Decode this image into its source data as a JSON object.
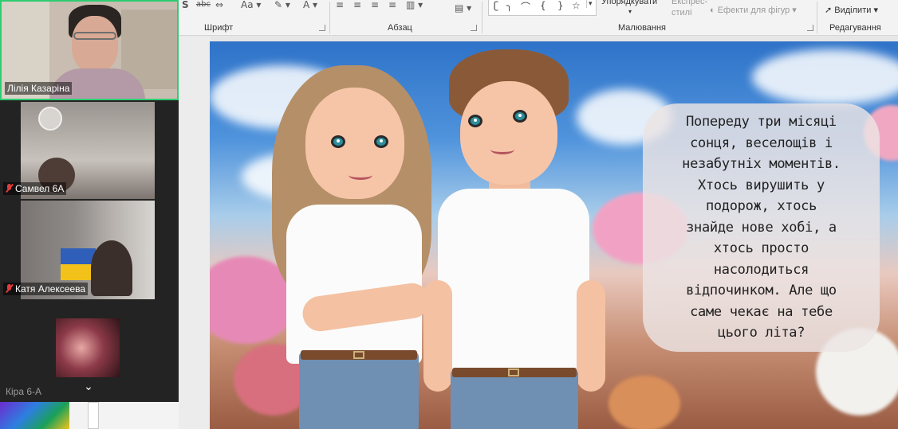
{
  "ribbon": {
    "groups": [
      {
        "label": "Шрифт"
      },
      {
        "label": "Абзац"
      },
      {
        "label": "Малювання"
      },
      {
        "label": "Редагування"
      }
    ],
    "arrange_label": "Упорядкувати",
    "quick_styles_line1": "Експрес-",
    "quick_styles_line2": "стилі",
    "shape_effects_label": "Ефекти для фігур",
    "select_label": "Виділити",
    "font_icons": [
      "strikethrough-icon",
      "abc-icon",
      "change-case-icon",
      "highlight-icon",
      "font-color-icon"
    ],
    "paragraph_icons": [
      "align-left-icon",
      "align-center-icon",
      "align-right-icon",
      "justify-icon"
    ]
  },
  "slide": {
    "text": "Попереду три місяці сонця, веселощів і незабутніх моментів. Хтось вирушить у подорож, хтось знайде нове хобі, а хтось просто насолодиться відпочинком. Але що саме чекає на тебе цього літа?",
    "text_lines": [
      "Попереду три місяці",
      "сонця, веселощів і",
      "незабутніх моментів.",
      "Хтось вирушить у",
      "подорож, хтось",
      "знайде нове хобі, а",
      "хтось просто",
      "насолодиться",
      "відпочинком. Але що",
      "саме чекає на тебе",
      "цього літа?"
    ]
  },
  "participants": [
    {
      "name": "Лілія Казаріна",
      "muted": false,
      "active_speaker": true
    },
    {
      "name": "Самвел 6А",
      "muted": true
    },
    {
      "name": "Катя Алексеева",
      "muted": true
    },
    {
      "name": "Кіра 6-А",
      "muted": false
    }
  ],
  "colors": {
    "active_speaker_border": "#2ecc71",
    "panel_bg": "#232323",
    "ribbon_bg": "#f3f3f3",
    "muted_icon": "#e23b3b"
  }
}
